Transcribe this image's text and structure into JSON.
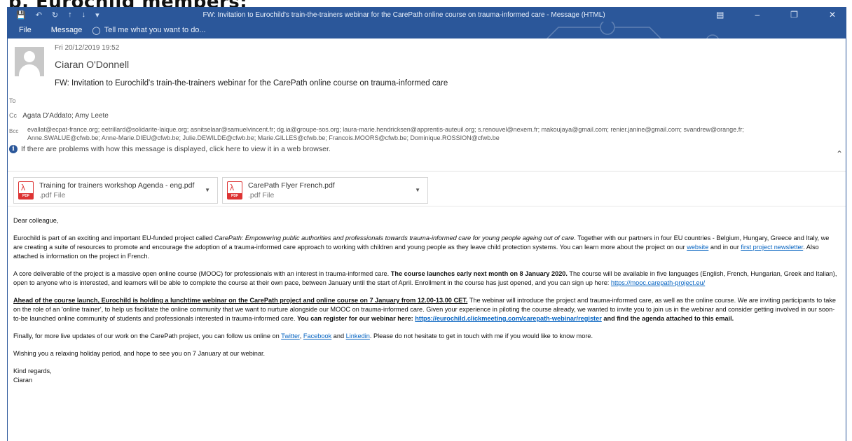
{
  "page_heading": "b. Eurochild members:",
  "titlebar": {
    "title": "FW: Invitation to Eurochild's train-the-trainers webinar for the CarePath online course on trauma-informed care - Message (HTML)"
  },
  "ribbon": {
    "tabs": [
      "File",
      "Message"
    ],
    "tell_me": "Tell me what you want to do..."
  },
  "header": {
    "date": "Fri 20/12/2019 19:52",
    "sender": "Ciaran O'Donnell",
    "subject": "FW: Invitation to Eurochild's train-the-trainers webinar for the CarePath online course on trauma-informed care",
    "to_label": "To",
    "cc_label": "Cc",
    "cc": "Agata D'Addato; Amy Leete",
    "bcc_label": "Bcc",
    "bcc_line1": "evallat@ecpat-france.org; eetrillard@solidarite-laique.org; asnitselaar@samuelvincent.fr; dg.ia@groupe-sos.org; laura-marie.hendricksen@apprentis-auteuil.org; s.renouvel@nexem.fr; makoujaya@gmail.com; renier.janine@gmail.com; svandrew@orange.fr;",
    "bcc_line2": "Anne.SWALUE@cfwb.be; Anne-Marie.DIEU@cfwb.be; Julie.DEWILDE@cfwb.be; Marie.GILLES@cfwb.be; Francois.MOORS@cfwb.be; Dominique.ROSSION@cfwb.be",
    "notice": "If there are problems with how this message is displayed, click here to view it in a web browser."
  },
  "attachments": [
    {
      "name": "Training for trainers workshop Agenda - eng.pdf",
      "type": ".pdf File"
    },
    {
      "name": "CarePath Flyer French.pdf",
      "type": ".pdf File"
    }
  ],
  "message": {
    "greeting": "Dear colleague,",
    "p1": {
      "a": "Eurochild is part of an exciting and important EU-funded project called ",
      "italic": "CarePath: Empowering public authorities and professionals towards trauma-informed care for young people ageing out of care",
      "b": ". Together with our partners in four EU countries - Belgium, Hungary, Greece and Italy, we are creating a suite of resources to promote and encourage the adoption of a trauma-informed care approach to working with children and young people as they leave child protection systems. You can learn more about the project on our ",
      "link1": "website",
      "c": " and in our ",
      "link2": "first project newsletter",
      "d": ". Also attached is information on the project in French."
    },
    "p2": {
      "a": "A core deliverable of the project is a massive open online course (MOOC) for professionals with an interest in trauma-informed care. ",
      "bold": "The course launches early next month on 8 January 2020.",
      "b": " The course will be available in five languages (English, French, Hungarian, Greek and Italian), open to anyone who is interested, and learners will be able to complete the course at their own pace, between January until the start of April. Enrollment in the course has just opened, and you can sign up here: ",
      "link": "https://mooc.carepath-project.eu/"
    },
    "p3": {
      "bold_underline": "Ahead of the course launch, Eurochild is holding a lunchtime webinar on the CarePath project and online course on 7 January from 12.00-13.00 CET.",
      "a": " The webinar will introduce the project and trauma-informed care, as well as the online course. We are inviting participants to take on the role of an 'online trainer', to help us facilitate the online community that we want to nurture alongside our MOOC on trauma-informed care. Given your experience in piloting the course already, we wanted to invite you to join us in the webinar and consider getting involved in our soon-to-be launched online community of students and professionals interested in trauma-informed care. ",
      "bold1": "You can register for our webinar here: ",
      "link": "https://eurochild.clickmeeting.com/carepath-webinar/register",
      "bold2": " and find the agenda attached to this email."
    },
    "p4": {
      "a": "Finally, for more live updates of our work on the CarePath project, you can follow us online on ",
      "link1": "Twitter",
      "sep1": ", ",
      "link2": "Facebook",
      "sep2": " and ",
      "link3": "Linkedin",
      "b": ". Please do not hesitate to get in touch with me if you would like to know more."
    },
    "p5": "Wishing you a relaxing holiday period, and hope to see you on 7 January at our webinar.",
    "signoff": "Kind regards,",
    "signature": "Ciaran"
  },
  "colors": {
    "titlebar": "#2b579a",
    "link": "#0563c1",
    "pdf_red": "#d33"
  }
}
